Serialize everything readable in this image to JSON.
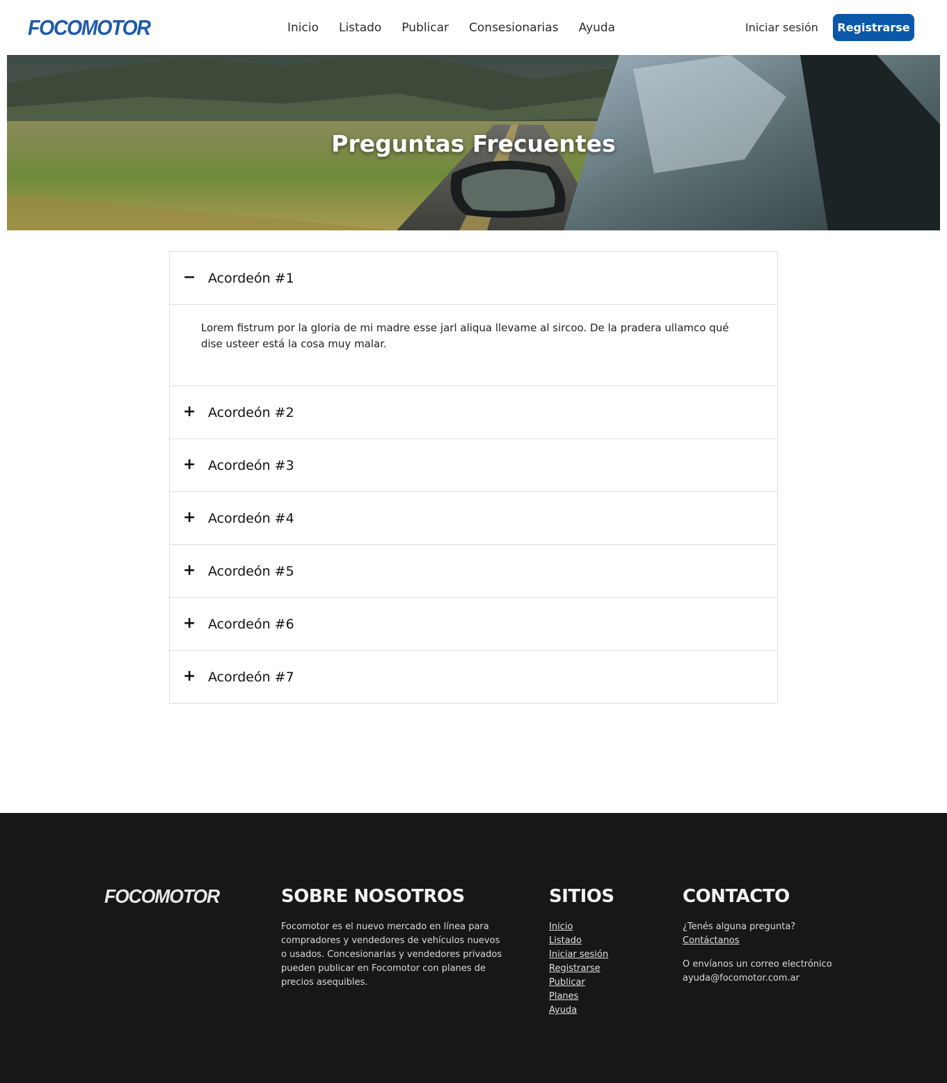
{
  "brand": {
    "name": "FOCOMOTOR",
    "color": "#1f5aa8"
  },
  "nav": {
    "items": [
      "Inicio",
      "Listado",
      "Publicar",
      "Consesionarias",
      "Ayuda"
    ],
    "login": "Iniciar sesión",
    "register": "Registrarse",
    "register_color": "#0b57a8"
  },
  "hero": {
    "title": "Preguntas Frecuentes"
  },
  "faq": {
    "items": [
      {
        "title": "Acordeón #1",
        "icon": "minus-icon",
        "expanded": true,
        "body": "Lorem fistrum por la gloria de mi madre esse jarl aliqua llevame al sircoo. De la pradera ullamco qué dise usteer está la cosa muy malar."
      },
      {
        "title": "Acordeón #2",
        "icon": "plus-icon",
        "expanded": false
      },
      {
        "title": "Acordeón #3",
        "icon": "plus-icon",
        "expanded": false
      },
      {
        "title": "Acordeón #4",
        "icon": "plus-icon",
        "expanded": false
      },
      {
        "title": "Acordeón #5",
        "icon": "plus-icon",
        "expanded": false
      },
      {
        "title": "Acordeón #6",
        "icon": "plus-icon",
        "expanded": false
      },
      {
        "title": "Acordeón #7",
        "icon": "plus-icon",
        "expanded": false
      }
    ]
  },
  "footer": {
    "logo": "FOCOMOTOR",
    "about": {
      "title": "SOBRE NOSOTROS",
      "text": "Focomotor es el nuevo mercado en línea para compradores y vendedores de vehículos nuevos o usados. Concesionarias y vendedores privados pueden publicar en Focomotor con planes de precios asequibles."
    },
    "sites": {
      "title": "SITIOS",
      "links": [
        "Inicio",
        "Listado",
        "Iniciar sesión",
        "Registrarse",
        "Publicar",
        "Planes",
        "Ayuda"
      ]
    },
    "contact": {
      "title": "CONTACTO",
      "question": "¿Tenés alguna pregunta?",
      "link": "Contáctanos",
      "email_intro": "O envíanos un correo electrónico",
      "email": "ayuda@focomotor.com.ar"
    },
    "background": "#171717"
  }
}
